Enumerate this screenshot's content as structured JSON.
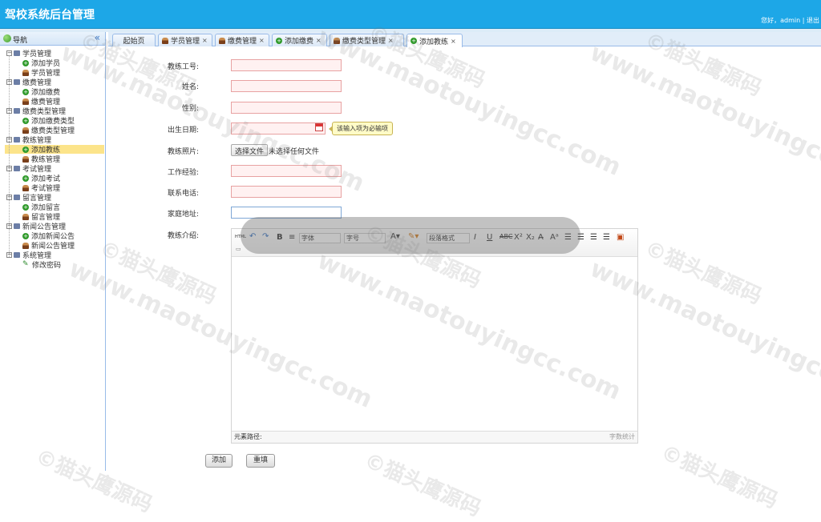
{
  "app": {
    "title": "驾校系统后台管理",
    "user_greeting": "您好，admin | 退出"
  },
  "nav": {
    "title": "导航",
    "collapse": "«",
    "groups": [
      {
        "label": "学员管理",
        "items": [
          {
            "label": "添加学员",
            "icon": "add-icon"
          },
          {
            "label": "学员管理",
            "icon": "user-icon"
          }
        ]
      },
      {
        "label": "缴费管理",
        "items": [
          {
            "label": "添加缴费",
            "icon": "add-icon"
          },
          {
            "label": "缴费管理",
            "icon": "user-icon"
          }
        ]
      },
      {
        "label": "缴费类型管理",
        "items": [
          {
            "label": "添加缴费类型",
            "icon": "add-icon"
          },
          {
            "label": "缴费类型管理",
            "icon": "user-icon"
          }
        ]
      },
      {
        "label": "教练管理",
        "items": [
          {
            "label": "添加教练",
            "icon": "add-icon",
            "selected": true
          },
          {
            "label": "教练管理",
            "icon": "user-icon"
          }
        ]
      },
      {
        "label": "考试管理",
        "items": [
          {
            "label": "添加考试",
            "icon": "add-icon"
          },
          {
            "label": "考试管理",
            "icon": "user-icon"
          }
        ]
      },
      {
        "label": "留言管理",
        "items": [
          {
            "label": "添加留言",
            "icon": "add-icon"
          },
          {
            "label": "留言管理",
            "icon": "user-icon"
          }
        ]
      },
      {
        "label": "新闻公告管理",
        "items": [
          {
            "label": "添加新闻公告",
            "icon": "add-icon"
          },
          {
            "label": "新闻公告管理",
            "icon": "user-icon"
          }
        ]
      },
      {
        "label": "系统管理",
        "items": [
          {
            "label": "修改密码",
            "icon": "pencil-icon"
          }
        ]
      }
    ]
  },
  "tabs": [
    {
      "label": "起始页",
      "icon": "",
      "closable": false
    },
    {
      "label": "学员管理",
      "icon": "user-icon",
      "closable": true
    },
    {
      "label": "缴费管理",
      "icon": "user-icon",
      "closable": true
    },
    {
      "label": "添加缴费",
      "icon": "add-icon",
      "closable": true
    },
    {
      "label": "缴费类型管理",
      "icon": "user-icon",
      "closable": true
    },
    {
      "label": "添加教练",
      "icon": "add-icon",
      "closable": true,
      "active": true
    }
  ],
  "form": {
    "coach_id_label": "教练工号:",
    "name_label": "姓名:",
    "gender_label": "性别:",
    "birthday_label": "出生日期:",
    "birthday_tip": "该输入项为必输项",
    "photo_label": "教练照片:",
    "choose_file": "选择文件",
    "no_file": "未选择任何文件",
    "experience_label": "工作经验:",
    "phone_label": "联系电话:",
    "address_label": "家庭地址:",
    "intro_label": "教练介绍:",
    "editor": {
      "font_family": "字体",
      "font_size": "字号",
      "paragraph": "段落格式",
      "path_label": "元素路径:",
      "word_count": "字数统计"
    },
    "submit": "添加",
    "reset": "重填"
  },
  "watermark": {
    "cn": "©猫头鹰源码",
    "url": "www.maotouyingcc.com"
  },
  "colors": {
    "header": "#1da7e7",
    "selected": "#fce48a",
    "required_bg": "#fff1f1"
  }
}
